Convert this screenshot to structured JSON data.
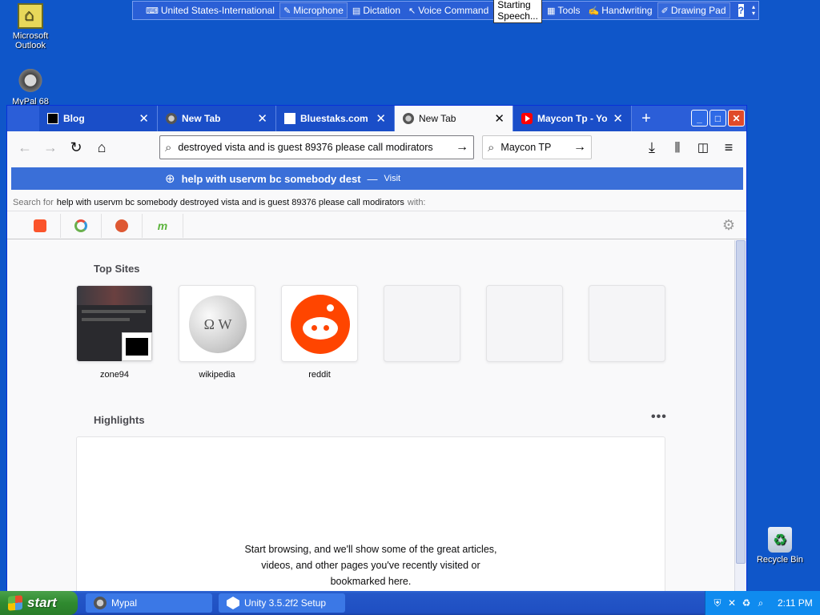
{
  "desktop": {
    "icons": [
      {
        "label_line1": "Microsoft",
        "label_line2": "Outlook"
      },
      {
        "label_line1": "MyPal 68",
        "label_line2": ""
      },
      {
        "label_line1": "Recycle Bin",
        "label_line2": ""
      }
    ]
  },
  "language_bar": {
    "keyboard": "United States-International",
    "microphone": "Microphone",
    "dictation": "Dictation",
    "voice_command": "Voice Command",
    "status": "Starting Speech...",
    "tools": "Tools",
    "handwriting": "Handwriting",
    "drawing_pad": "Drawing Pad",
    "help": "?"
  },
  "browser": {
    "tabs": [
      {
        "label": "Blog",
        "favicon": "blog-icon",
        "active": false
      },
      {
        "label": "New Tab",
        "favicon": "raccoon-icon",
        "active": false
      },
      {
        "label": "Bluestaks.com",
        "favicon": "blank-page-icon",
        "active": false
      },
      {
        "label": "New Tab",
        "favicon": "raccoon-icon",
        "active": true
      },
      {
        "label": "Maycon Tp - YouT",
        "favicon": "youtube-icon",
        "active": false
      }
    ],
    "url_value": "destroyed vista and is guest 89376 please call modirators",
    "search_value": "Maycon TP",
    "dropdown": {
      "heading_text": "help with uservm bc somebody dest",
      "visit_label": "Visit",
      "search_for_prefix": "Search for",
      "search_for_query": "help with uservm bc somebody destroyed vista and is guest 89376 please call modirators",
      "search_for_suffix": "with:"
    },
    "newtab": {
      "top_sites_title": "Top Sites",
      "top_sites": [
        {
          "label": "zone94"
        },
        {
          "label": "wikipedia"
        },
        {
          "label": "reddit"
        },
        {
          "label": ""
        },
        {
          "label": ""
        },
        {
          "label": ""
        }
      ],
      "highlights_title": "Highlights",
      "highlights_message_line1": "Start browsing, and we'll show some of the great articles,",
      "highlights_message_line2": "videos, and other pages you've recently visited or",
      "highlights_message_line3": "bookmarked here."
    }
  },
  "taskbar": {
    "start_label": "start",
    "tasks": [
      {
        "label": "Mypal"
      },
      {
        "label": "Unity 3.5.2f2 Setup"
      }
    ],
    "clock": "2:11 PM"
  },
  "colors": {
    "desktop": "#0f56c9",
    "tabbar": "#2b5ed8",
    "taskbar": "#1f4fc2",
    "start": "#2f8a2f",
    "reddit": "#ff4500"
  }
}
